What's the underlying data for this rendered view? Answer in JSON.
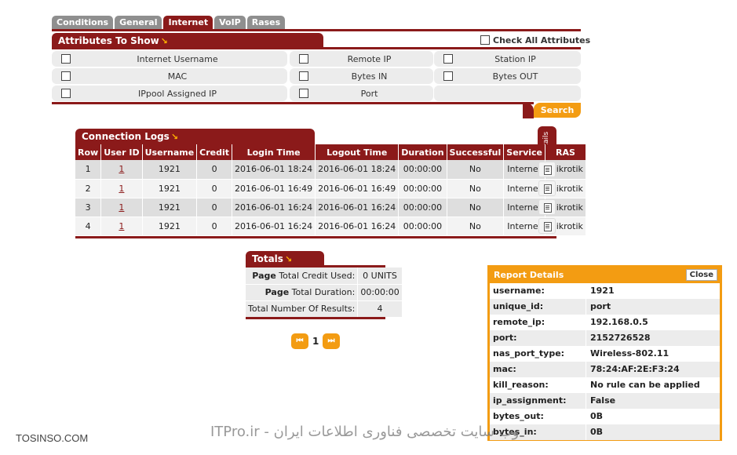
{
  "tabs": [
    "Conditions",
    "General",
    "Internet",
    "VoIP",
    "Rases"
  ],
  "active_tab": "Internet",
  "attributes": {
    "title": "Attributes To Show",
    "check_all_label": "Check All Attributes",
    "items": [
      {
        "label": "Internet Username"
      },
      {
        "label": "Remote IP"
      },
      {
        "label": "Station IP"
      },
      {
        "label": "MAC"
      },
      {
        "label": "Bytes IN"
      },
      {
        "label": "Bytes OUT"
      },
      {
        "label": "IPpool Assigned IP"
      },
      {
        "label": "Port"
      }
    ],
    "search_label": "Search"
  },
  "connection_logs": {
    "title": "Connection Logs",
    "details_label": "Details",
    "columns": [
      "Row",
      "User ID",
      "Username",
      "Credit",
      "Login Time",
      "Logout Time",
      "Duration",
      "Successful",
      "Service",
      "RAS"
    ],
    "rows": [
      [
        "1",
        "1",
        "1921",
        "0",
        "2016-06-01 18:24",
        "2016-06-01 18:24",
        "00:00:00",
        "No",
        "Internet",
        "mikrotik"
      ],
      [
        "2",
        "1",
        "1921",
        "0",
        "2016-06-01 16:49",
        "2016-06-01 16:49",
        "00:00:00",
        "No",
        "Internet",
        "mikrotik"
      ],
      [
        "3",
        "1",
        "1921",
        "0",
        "2016-06-01 16:24",
        "2016-06-01 16:24",
        "00:00:00",
        "No",
        "Internet",
        "mikrotik"
      ],
      [
        "4",
        "1",
        "1921",
        "0",
        "2016-06-01 16:24",
        "2016-06-01 16:24",
        "00:00:00",
        "No",
        "Internet",
        "mikrotik"
      ]
    ]
  },
  "totals": {
    "title": "Totals",
    "rows": [
      {
        "bold": "Page",
        "key": " Total Credit Used:",
        "value": "0 UNITS"
      },
      {
        "bold": "Page",
        "key": " Total Duration:",
        "value": "00:00:00"
      },
      {
        "bold": "",
        "key": "Total Number Of Results:",
        "value": "4"
      }
    ]
  },
  "pager": {
    "current_page": "1",
    "first_icon": "first-page-icon",
    "last_icon": "last-page-icon"
  },
  "report_details": {
    "title": "Report Details",
    "close_label": "Close",
    "rows": [
      {
        "key": "username:",
        "value": "1921"
      },
      {
        "key": "unique_id:",
        "value": "port"
      },
      {
        "key": "remote_ip:",
        "value": "192.168.0.5"
      },
      {
        "key": "port:",
        "value": "2152726528"
      },
      {
        "key": "nas_port_type:",
        "value": "Wireless-802.11"
      },
      {
        "key": "mac:",
        "value": "78:24:AF:2E:F3:24"
      },
      {
        "key": "kill_reason:",
        "value": "No rule can be applied"
      },
      {
        "key": "ip_assignment:",
        "value": "False"
      },
      {
        "key": "bytes_out:",
        "value": "0B"
      },
      {
        "key": "bytes_in:",
        "value": "0B"
      }
    ]
  },
  "watermarks": {
    "left": "TOSINSO.COM",
    "center": "ITPro.ir - وب سایت تخصصی فناوری اطلاعات ایران"
  },
  "colors": {
    "primary": "#8b1a1a",
    "accent": "#f39c12",
    "tab_inactive": "#8f8f8f"
  }
}
